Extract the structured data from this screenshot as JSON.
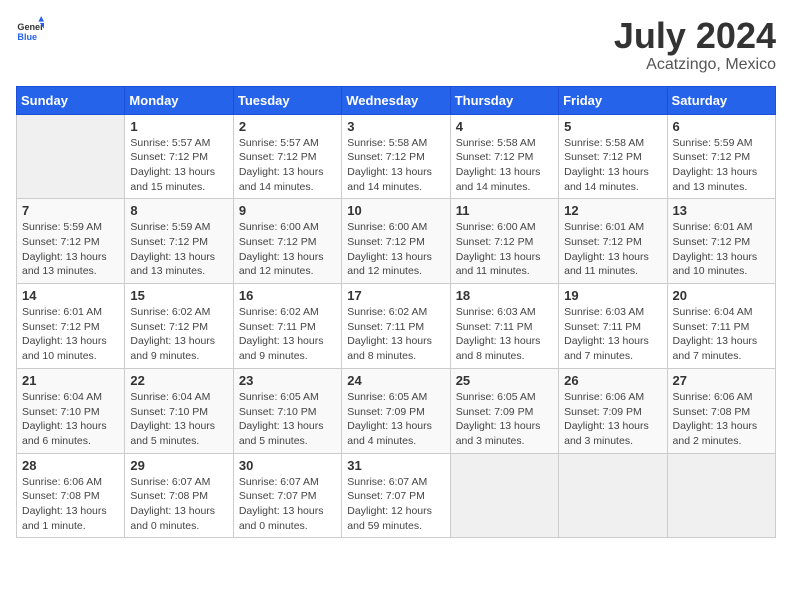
{
  "header": {
    "logo_general": "General",
    "logo_blue": "Blue",
    "month_year": "July 2024",
    "location": "Acatzingo, Mexico"
  },
  "weekdays": [
    "Sunday",
    "Monday",
    "Tuesday",
    "Wednesday",
    "Thursday",
    "Friday",
    "Saturday"
  ],
  "weeks": [
    [
      {
        "day": "",
        "sunrise": "",
        "sunset": "",
        "daylight": ""
      },
      {
        "day": "1",
        "sunrise": "Sunrise: 5:57 AM",
        "sunset": "Sunset: 7:12 PM",
        "daylight": "Daylight: 13 hours and 15 minutes."
      },
      {
        "day": "2",
        "sunrise": "Sunrise: 5:57 AM",
        "sunset": "Sunset: 7:12 PM",
        "daylight": "Daylight: 13 hours and 14 minutes."
      },
      {
        "day": "3",
        "sunrise": "Sunrise: 5:58 AM",
        "sunset": "Sunset: 7:12 PM",
        "daylight": "Daylight: 13 hours and 14 minutes."
      },
      {
        "day": "4",
        "sunrise": "Sunrise: 5:58 AM",
        "sunset": "Sunset: 7:12 PM",
        "daylight": "Daylight: 13 hours and 14 minutes."
      },
      {
        "day": "5",
        "sunrise": "Sunrise: 5:58 AM",
        "sunset": "Sunset: 7:12 PM",
        "daylight": "Daylight: 13 hours and 14 minutes."
      },
      {
        "day": "6",
        "sunrise": "Sunrise: 5:59 AM",
        "sunset": "Sunset: 7:12 PM",
        "daylight": "Daylight: 13 hours and 13 minutes."
      }
    ],
    [
      {
        "day": "7",
        "sunrise": "Sunrise: 5:59 AM",
        "sunset": "Sunset: 7:12 PM",
        "daylight": "Daylight: 13 hours and 13 minutes."
      },
      {
        "day": "8",
        "sunrise": "Sunrise: 5:59 AM",
        "sunset": "Sunset: 7:12 PM",
        "daylight": "Daylight: 13 hours and 13 minutes."
      },
      {
        "day": "9",
        "sunrise": "Sunrise: 6:00 AM",
        "sunset": "Sunset: 7:12 PM",
        "daylight": "Daylight: 13 hours and 12 minutes."
      },
      {
        "day": "10",
        "sunrise": "Sunrise: 6:00 AM",
        "sunset": "Sunset: 7:12 PM",
        "daylight": "Daylight: 13 hours and 12 minutes."
      },
      {
        "day": "11",
        "sunrise": "Sunrise: 6:00 AM",
        "sunset": "Sunset: 7:12 PM",
        "daylight": "Daylight: 13 hours and 11 minutes."
      },
      {
        "day": "12",
        "sunrise": "Sunrise: 6:01 AM",
        "sunset": "Sunset: 7:12 PM",
        "daylight": "Daylight: 13 hours and 11 minutes."
      },
      {
        "day": "13",
        "sunrise": "Sunrise: 6:01 AM",
        "sunset": "Sunset: 7:12 PM",
        "daylight": "Daylight: 13 hours and 10 minutes."
      }
    ],
    [
      {
        "day": "14",
        "sunrise": "Sunrise: 6:01 AM",
        "sunset": "Sunset: 7:12 PM",
        "daylight": "Daylight: 13 hours and 10 minutes."
      },
      {
        "day": "15",
        "sunrise": "Sunrise: 6:02 AM",
        "sunset": "Sunset: 7:12 PM",
        "daylight": "Daylight: 13 hours and 9 minutes."
      },
      {
        "day": "16",
        "sunrise": "Sunrise: 6:02 AM",
        "sunset": "Sunset: 7:11 PM",
        "daylight": "Daylight: 13 hours and 9 minutes."
      },
      {
        "day": "17",
        "sunrise": "Sunrise: 6:02 AM",
        "sunset": "Sunset: 7:11 PM",
        "daylight": "Daylight: 13 hours and 8 minutes."
      },
      {
        "day": "18",
        "sunrise": "Sunrise: 6:03 AM",
        "sunset": "Sunset: 7:11 PM",
        "daylight": "Daylight: 13 hours and 8 minutes."
      },
      {
        "day": "19",
        "sunrise": "Sunrise: 6:03 AM",
        "sunset": "Sunset: 7:11 PM",
        "daylight": "Daylight: 13 hours and 7 minutes."
      },
      {
        "day": "20",
        "sunrise": "Sunrise: 6:04 AM",
        "sunset": "Sunset: 7:11 PM",
        "daylight": "Daylight: 13 hours and 7 minutes."
      }
    ],
    [
      {
        "day": "21",
        "sunrise": "Sunrise: 6:04 AM",
        "sunset": "Sunset: 7:10 PM",
        "daylight": "Daylight: 13 hours and 6 minutes."
      },
      {
        "day": "22",
        "sunrise": "Sunrise: 6:04 AM",
        "sunset": "Sunset: 7:10 PM",
        "daylight": "Daylight: 13 hours and 5 minutes."
      },
      {
        "day": "23",
        "sunrise": "Sunrise: 6:05 AM",
        "sunset": "Sunset: 7:10 PM",
        "daylight": "Daylight: 13 hours and 5 minutes."
      },
      {
        "day": "24",
        "sunrise": "Sunrise: 6:05 AM",
        "sunset": "Sunset: 7:09 PM",
        "daylight": "Daylight: 13 hours and 4 minutes."
      },
      {
        "day": "25",
        "sunrise": "Sunrise: 6:05 AM",
        "sunset": "Sunset: 7:09 PM",
        "daylight": "Daylight: 13 hours and 3 minutes."
      },
      {
        "day": "26",
        "sunrise": "Sunrise: 6:06 AM",
        "sunset": "Sunset: 7:09 PM",
        "daylight": "Daylight: 13 hours and 3 minutes."
      },
      {
        "day": "27",
        "sunrise": "Sunrise: 6:06 AM",
        "sunset": "Sunset: 7:08 PM",
        "daylight": "Daylight: 13 hours and 2 minutes."
      }
    ],
    [
      {
        "day": "28",
        "sunrise": "Sunrise: 6:06 AM",
        "sunset": "Sunset: 7:08 PM",
        "daylight": "Daylight: 13 hours and 1 minute."
      },
      {
        "day": "29",
        "sunrise": "Sunrise: 6:07 AM",
        "sunset": "Sunset: 7:08 PM",
        "daylight": "Daylight: 13 hours and 0 minutes."
      },
      {
        "day": "30",
        "sunrise": "Sunrise: 6:07 AM",
        "sunset": "Sunset: 7:07 PM",
        "daylight": "Daylight: 13 hours and 0 minutes."
      },
      {
        "day": "31",
        "sunrise": "Sunrise: 6:07 AM",
        "sunset": "Sunset: 7:07 PM",
        "daylight": "Daylight: 12 hours and 59 minutes."
      },
      {
        "day": "",
        "sunrise": "",
        "sunset": "",
        "daylight": ""
      },
      {
        "day": "",
        "sunrise": "",
        "sunset": "",
        "daylight": ""
      },
      {
        "day": "",
        "sunrise": "",
        "sunset": "",
        "daylight": ""
      }
    ]
  ]
}
